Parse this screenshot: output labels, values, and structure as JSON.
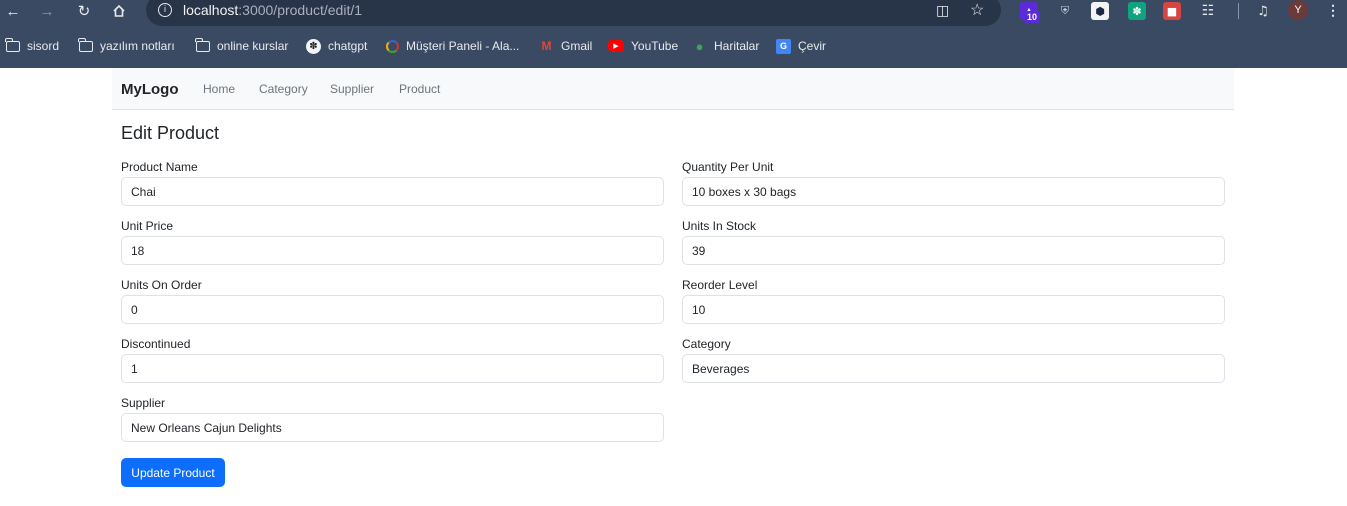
{
  "browser": {
    "url_host": "localhost",
    "url_path": ":3000/product/edit/1",
    "ext_badge": "10",
    "avatar_initial": "Y",
    "bookmarks": [
      {
        "label": "sisord",
        "icon": "folder-icon"
      },
      {
        "label": "yazılım notları",
        "icon": "folder-icon"
      },
      {
        "label": "online kurslar",
        "icon": "folder-icon"
      },
      {
        "label": "chatgpt",
        "icon": "chatgpt-icon"
      },
      {
        "label": "Müşteri Paneli - Ala...",
        "icon": "panel-icon"
      },
      {
        "label": "Gmail",
        "icon": "gmail-icon"
      },
      {
        "label": "YouTube",
        "icon": "youtube-icon"
      },
      {
        "label": "Haritalar",
        "icon": "maps-icon"
      },
      {
        "label": "Çevir",
        "icon": "translate-icon"
      }
    ]
  },
  "navbar": {
    "brand": "MyLogo",
    "links": [
      "Home",
      "Category",
      "Supplier",
      "Product"
    ]
  },
  "form": {
    "title": "Edit Product",
    "product_name": {
      "label": "Product Name",
      "value": "Chai"
    },
    "quantity_per_unit": {
      "label": "Quantity Per Unit",
      "value": "10 boxes x 30 bags"
    },
    "unit_price": {
      "label": "Unit Price",
      "value": "18"
    },
    "units_in_stock": {
      "label": "Units In Stock",
      "value": "39"
    },
    "units_on_order": {
      "label": "Units On Order",
      "value": "0"
    },
    "reorder_level": {
      "label": "Reorder Level",
      "value": "10"
    },
    "discontinued": {
      "label": "Discontinued",
      "value": "1"
    },
    "category": {
      "label": "Category",
      "value": "Beverages"
    },
    "supplier": {
      "label": "Supplier",
      "value": "New Orleans Cajun Delights"
    },
    "submit_label": "Update Product"
  },
  "colors": {
    "chrome": "#3b4a63",
    "primary": "#0d6efd"
  }
}
